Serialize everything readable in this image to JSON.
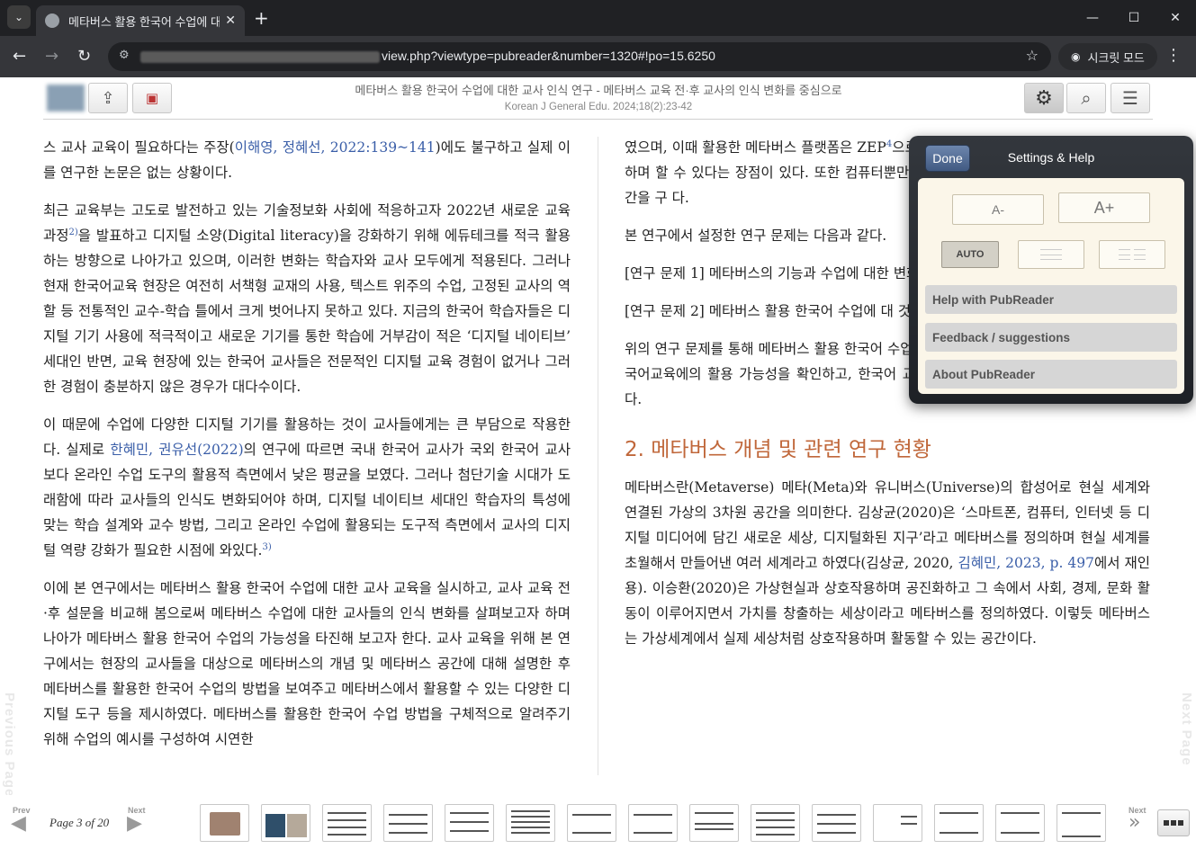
{
  "browser": {
    "tab_title": "메타버스 활용 한국어 수업에 대",
    "url": "view.php?viewtype=pubreader&number=1320#!po=15.6250",
    "incognito_label": "시크릿 모드"
  },
  "reader": {
    "doc_title": "메타버스 활용 한국어 수업에 대한 교사 인식 연구 - 메타버스 교육 전·후 교사의 인식 변화를 중심으로",
    "doc_citation": "Korean J General Edu. 2024;18(2):23-42"
  },
  "left_column": {
    "p1_a": "스 교사 교육이 필요하다는 주장(",
    "p1_link": "이해영, 정혜선, 2022:139~141",
    "p1_b": ")에도 불구하고 실제 이를 연구한 논문은 없는 상황이다.",
    "p2_a": "최근 교육부는 고도로 발전하고 있는 기술정보화 사회에 적응하고자 2022년 새로운 교육과정",
    "p2_sup": "2)",
    "p2_b": "을 발표하고 디지털 소양(Digital literacy)을 강화하기 위해 에듀테크를 적극 활용하는 방향으로 나아가고 있으며, 이러한 변화는 학습자와 교사 모두에게 적용된다. 그러나 현재 한국어교육 현장은 여전히 서책형 교재의 사용, 텍스트 위주의 수업, 고정된 교사의 역할 등 전통적인 교수-학습 틀에서 크게 벗어나지 못하고 있다. 지금의 한국어 학습자들은 디지털 기기 사용에 적극적이고 새로운 기기를 통한 학습에 거부감이 적은 ‘디지털 네이티브’ 세대인 반면, 교육 현장에 있는 한국어 교사들은 전문적인 디지털 교육 경험이 없거나 그러한 경험이 충분하지 않은 경우가 대다수이다.",
    "p3_a": "이 때문에 수업에 다양한 디지털 기기를 활용하는 것이 교사들에게는 큰 부담으로 작용한다. 실제로 ",
    "p3_link": "한혜민, 권유선(2022)",
    "p3_b": "의 연구에 따르면 국내 한국어 교사가 국외 한국어 교사보다 온라인 수업 도구의 활용적 측면에서 낮은 평균을 보였다. 그러나 첨단기술 시대가 도래함에 따라 교사들의 인식도 변화되어야 하며, 디지털 네이티브 세대인 학습자의 특성에 맞는 학습 설계와 교수 방법, 그리고 온라인 수업에 활용되는 도구적 측면에서 교사의 디지털 역량 강화가 필요한 시점에 와있다.",
    "p3_sup": "3)",
    "p4": "이에 본 연구에서는 메타버스 활용 한국어 수업에 대한 교사 교육을 실시하고, 교사 교육 전·후 설문을 비교해 봄으로써 메타버스 수업에 대한 교사들의 인식 변화를 살펴보고자 하며 나아가 메타버스 활용 한국어 수업의 가능성을 타진해 보고자 한다. 교사 교육을 위해 본 연구에서는 현장의 교사들을 대상으로 메타버스의 개념 및 메타버스 공간에 대해 설명한 후 메타버스를 활용한 한국어 수업의 방법을 보여주고 메타버스에서 활용할 수 있는 다양한 디지털 도구 등을 제시하였다. 메타버스를 활용한 한국어 수업 방법을 구체적으로 알려주기 위해 수업의 예시를 구성하여 시연한"
  },
  "right_column": {
    "p1_a": "였으며, 이때 활용한 메타버스 플랫폼은 ZEP",
    "p1_sup": "4",
    "p1_b": "으로, 자체적으로 제공하는 맵과 기능이 다양하며 할 수 있다는 장점이 있다. 또한 컴퓨터뿐만이 있으며, 교사가 학습 내용에 적합한 공간을 구 다.",
    "p2": "본 연구에서 설정한 연구 문제는 다음과 같다.",
    "p3": "[연구 문제 1] 메타버스의 기능과 수업에 대한 변화가 있는가?",
    "p4": "[연구 문제 2] 메타버스 활용 한국어 수업에 대 것은 무엇인가?",
    "p5": "위의 연구 문제를 통해 메타버스 활용 한국어 수업에 대해 교사들이 느끼는 수업 효과 및 한국어교육에의 활용 가능성을 확인하고, 한국어 교사 교육에 대한 시사점을 도출하고자 한다.",
    "section_heading": "2. 메타버스 개념 및 관련 연구 현황",
    "p6_a": "메타버스란(Metaverse) 메타(Meta)와 유니버스(Universe)의 합성어로 현실 세계와 연결된 가상의 3차원 공간을 의미한다. 김상균(2020)은 ‘스마트폰, 컴퓨터, 인터넷 등 디지털 미디어에 담긴 새로운 세상, 디지털화된 지구’라고 메타버스를 정의하며 현실 세계를 초월해서 만들어낸 여러 세계라고 하였다(김상균, 2020, ",
    "p6_link": "김혜민, 2023, p. 497",
    "p6_b": "에서 재인용). 이승환(2020)은 가상현실과 상호작용하며 공진화하고 그 속에서 사회, 경제, 문화 활동이 이루어지면서 가치를 창출하는 세상이라고 메타버스를 정의하였다. 이렇듯 메타버스는 가상세계에서 실제 세상처럼 상호작용하며 활동할 수 있는 공간이다."
  },
  "side": {
    "previous": "Previous Page",
    "next": "Next Page"
  },
  "settings": {
    "done": "Done",
    "title": "Settings & Help",
    "font_smaller": "A-",
    "font_larger": "A+",
    "auto": "AUTO",
    "help": "Help with PubReader",
    "feedback": "Feedback / suggestions",
    "about": "About PubReader"
  },
  "footer": {
    "prev": "Prev",
    "next": "Next",
    "page_indicator": "Page 3 of 20"
  }
}
